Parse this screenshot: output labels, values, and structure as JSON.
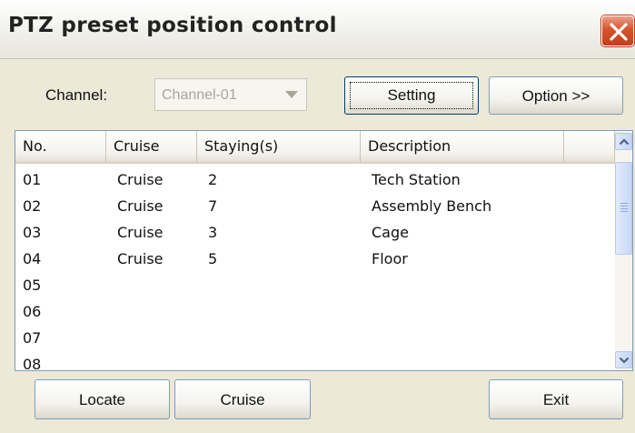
{
  "window": {
    "title": "PTZ preset position control"
  },
  "channel": {
    "label": "Channel:",
    "value": "Channel-01"
  },
  "buttons": {
    "setting": "Setting",
    "option": "Option >>",
    "locate": "Locate",
    "cruise": "Cruise",
    "exit": "Exit"
  },
  "table": {
    "columns": [
      "No.",
      "Cruise",
      "Staying(s)",
      "Description"
    ],
    "rows": [
      {
        "no": "01",
        "cruise": "Cruise",
        "staying": "2",
        "description": "Tech Station"
      },
      {
        "no": "02",
        "cruise": "Cruise",
        "staying": "7",
        "description": "Assembly Bench"
      },
      {
        "no": "03",
        "cruise": "Cruise",
        "staying": "3",
        "description": "Cage"
      },
      {
        "no": "04",
        "cruise": "Cruise",
        "staying": "5",
        "description": "Floor"
      },
      {
        "no": "05",
        "cruise": "",
        "staying": "",
        "description": ""
      },
      {
        "no": "06",
        "cruise": "",
        "staying": "",
        "description": ""
      },
      {
        "no": "07",
        "cruise": "",
        "staying": "",
        "description": ""
      },
      {
        "no": "08",
        "cruise": "",
        "staying": "",
        "description": ""
      }
    ]
  },
  "icons": {
    "close": "close-icon",
    "scroll_up": "chevron-up-icon",
    "scroll_down": "chevron-down-icon",
    "dropdown": "dropdown-arrow-icon"
  },
  "colors": {
    "window_bg": "#ece9d8",
    "close_button": "#d6542b",
    "disabled_text": "#a7a69c",
    "border": "#7f9db9"
  }
}
